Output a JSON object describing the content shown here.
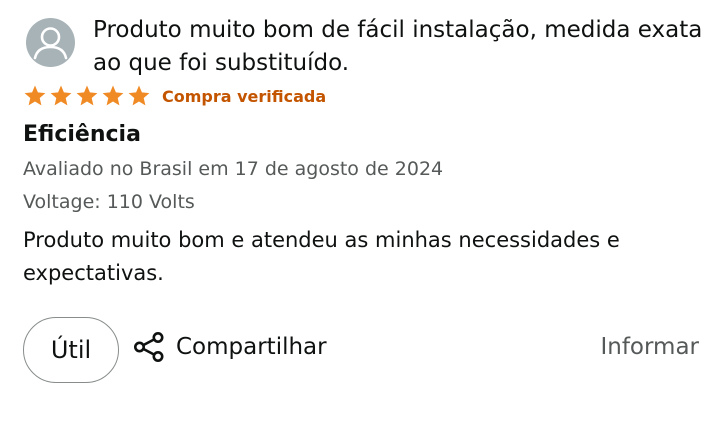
{
  "review": {
    "header_text": "Produto muito bom de fácil instalação, medida exata ao que foi substituído.",
    "rating": 5,
    "rating_max": 5,
    "verified_label": "Compra verificada",
    "title": "Eficiência",
    "date_line": "Avaliado no Brasil em 17 de agosto de 2024",
    "variant_line": "Voltage: 110 Volts",
    "body": "Produto muito bom e atendeu as minhas necessidades e expectativas."
  },
  "actions": {
    "helpful_label": "Útil",
    "share_label": "Compartilhar",
    "report_label": "Informar"
  },
  "icons": {
    "avatar": "default-user-avatar-icon",
    "star": "star-icon",
    "share": "share-icon"
  },
  "colors": {
    "star": "#f08a24",
    "verified": "#c45500",
    "secondary_text": "#565959",
    "avatar_bg": "#a8b3b8"
  }
}
